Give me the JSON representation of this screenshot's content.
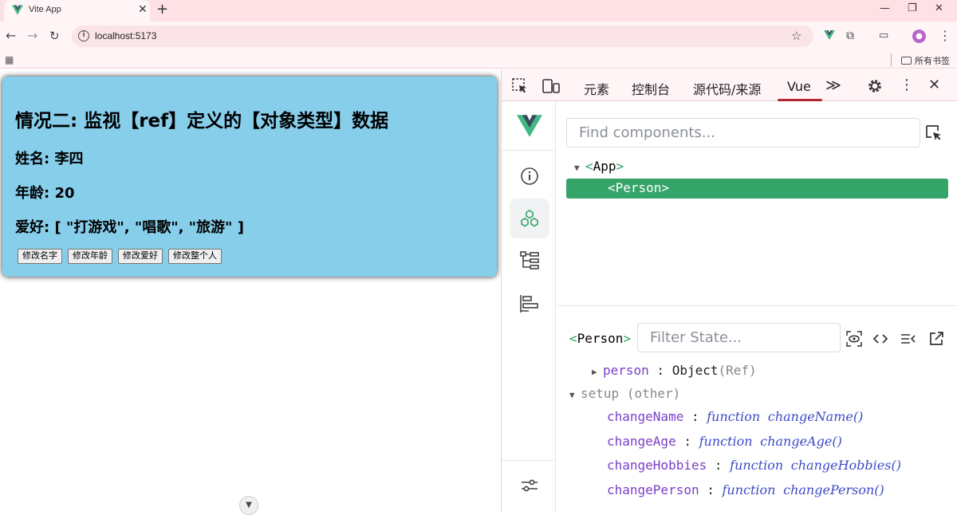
{
  "browser": {
    "tab_title": "Vite App",
    "tab_close": "✕",
    "new_tab": "+",
    "url": "localhost:5173",
    "bookmark_folder": "所有书签",
    "window_controls": {
      "minimize": "—",
      "restore": "❐",
      "close": "✕"
    }
  },
  "page": {
    "heading": "情况二: 监视【ref】定义的【对象类型】数据",
    "name_line": "姓名: 李四",
    "age_line": "年龄: 20",
    "hobby_line": "爱好: [ \"打游戏\", \"唱歌\", \"旅游\" ]",
    "buttons": [
      "修改名字",
      "修改年龄",
      "修改爱好",
      "修改整个人"
    ],
    "card_color": "#87ceeb"
  },
  "devtools": {
    "tabs": [
      "元素",
      "控制台",
      "源代码/来源",
      "Vue"
    ],
    "active_tab": "Vue",
    "more": "≫",
    "find_placeholder": "Find components...",
    "tree": {
      "root": "App",
      "child": "Person",
      "open_bracket": "<",
      "close_bracket": ">"
    },
    "state": {
      "component": "Person",
      "filter_placeholder": "Filter State...",
      "person_key": "person",
      "person_value": "Object",
      "person_ref": "(Ref)",
      "setup_label": "setup",
      "setup_other": "(other)",
      "functions": [
        {
          "key": "changeName",
          "kw": "function",
          "sig": "changeName()"
        },
        {
          "key": "changeAge",
          "kw": "function",
          "sig": "changeAge()"
        },
        {
          "key": "changeHobbies",
          "kw": "function",
          "sig": "changeHobbies()"
        },
        {
          "key": "changePerson",
          "kw": "function",
          "sig": "changePerson()"
        }
      ]
    },
    "accent": "#34a468"
  }
}
